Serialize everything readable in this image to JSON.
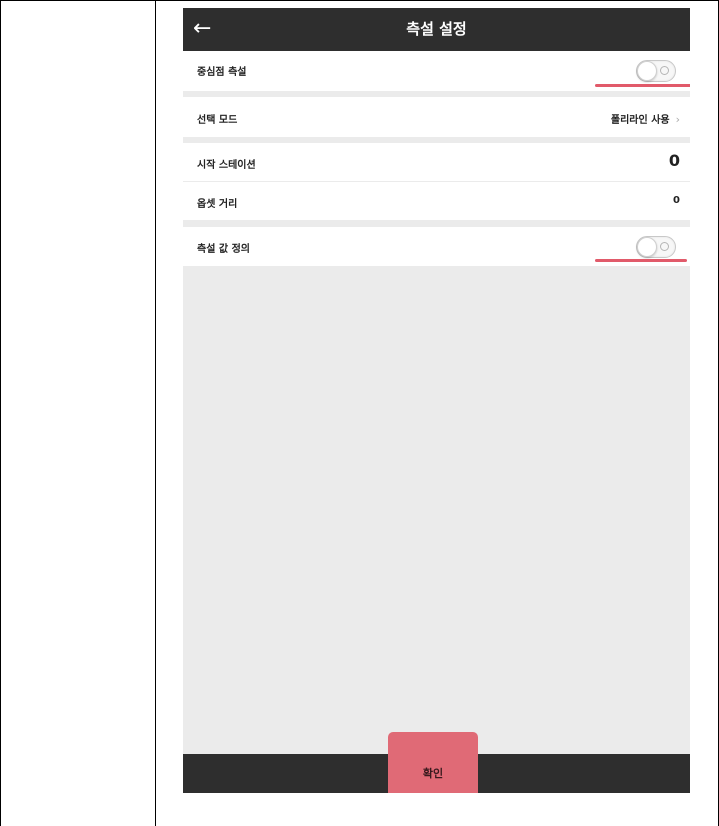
{
  "header": {
    "back_icon": "arrow-left-icon",
    "title": "측설 설정"
  },
  "settings": {
    "center_point": {
      "label": "중심점 측설",
      "enabled": false
    },
    "select_mode": {
      "label": "선택 모드",
      "value": "폴리라인 사용",
      "chevron": "›"
    },
    "start_station": {
      "label": "시작 스테이션",
      "value": "0"
    },
    "offset_distance": {
      "label": "옵셋 거리",
      "value": "0"
    },
    "stake_value_define": {
      "label": "측설 값 정의",
      "enabled": false
    }
  },
  "footer": {
    "confirm_label": "확인"
  },
  "colors": {
    "titlebar": "#2e2e2e",
    "accent": "#e06a76",
    "highlight_underline": "#e15a6a",
    "background": "#ebebeb"
  }
}
